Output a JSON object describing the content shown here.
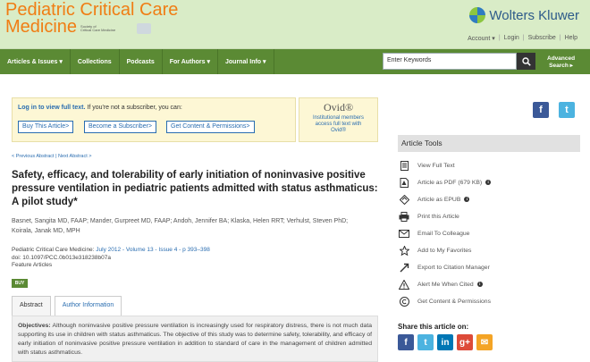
{
  "header": {
    "journal_title_line1": "Pediatric Critical Care",
    "journal_title_line2": "Medicine",
    "society_line1": "Society of",
    "society_line2": "Critical Care Medicine",
    "publisher": "Wolters Kluwer",
    "top_links": [
      "Account ▾",
      "Login",
      "Subscribe",
      "Help"
    ]
  },
  "nav": {
    "items": [
      "Articles & Issues ▾",
      "Collections",
      "Podcasts",
      "For Authors ▾",
      "Journal Info ▾"
    ],
    "search_placeholder": "Enter Keywords",
    "advanced_line1": "Advanced",
    "advanced_line2": "Search ▸"
  },
  "access": {
    "login_link": "Log in to view full text.",
    "login_rest": " If you're not a subscriber, you can:",
    "buttons": [
      "Buy This Article>",
      "Become a Subscriber>",
      "Get Content & Permissions>"
    ],
    "ovid_logo": "Ovid®",
    "ovid_line1": "Institutional members",
    "ovid_line2": "access full text with",
    "ovid_line3": "Ovid®"
  },
  "article": {
    "prev_next": "< Previous Abstract | Next Abstract >",
    "title": "Safety, efficacy, and tolerability of early initiation of noninvasive positive pressure ventilation in pediatric patients admitted with status asthmaticus: A pilot study*",
    "authors": "Basnet, Sangita MD, FAAP; Mander, Gurpreet MD, FAAP; Andoh, Jennifer BA; Klaska, Helen RRT; Verhulst, Steven PhD; Koirala, Janak MD, MPH",
    "citation_journal": "Pediatric Critical Care Medicine: ",
    "citation_issue": "July 2012 - Volume 13 - Issue 4 - p 393–398",
    "doi": "doi: 10.1097/PCC.0b013e318238b07a",
    "section": "Feature Articles",
    "buy_badge": "BUY",
    "tabs": [
      "Abstract",
      "Author Information"
    ],
    "abstract_label": "Objectives:",
    "abstract_text": " Although noninvasive positive pressure ventilation is increasingly used for respiratory distress, there is not much data supporting its use in children with status asthmaticus. The objective of this study was to determine safety, tolerability, and efficacy of early initiation of noninvasive positive pressure ventilation in addition to standard of care in the management of children admitted with status asthmaticus."
  },
  "sidebar": {
    "social_top": [
      "f",
      "t"
    ],
    "tools_title": "Article Tools",
    "tools": [
      {
        "label": "View Full Text",
        "icon": "document-icon",
        "info": false
      },
      {
        "label": "Article as PDF (679 KB)",
        "icon": "pdf-icon",
        "info": true
      },
      {
        "label": "Article as EPUB",
        "icon": "epub-icon",
        "info": true
      },
      {
        "label": "Print this Article",
        "icon": "printer-icon",
        "info": false
      },
      {
        "label": "Email To Colleague",
        "icon": "email-icon",
        "info": false
      },
      {
        "label": "Add to My Favorites",
        "icon": "star-icon",
        "info": false
      },
      {
        "label": "Export to Citation Manager",
        "icon": "export-icon",
        "info": false
      },
      {
        "label": "Alert Me When Cited",
        "icon": "alert-icon",
        "info": true
      },
      {
        "label": "Get Content & Permissions",
        "icon": "copyright-icon",
        "info": false
      }
    ],
    "share_title": "Share this article on:",
    "share_icons": [
      "f",
      "t",
      "in",
      "g+",
      "✉"
    ]
  },
  "colors": {
    "header_bg": "#d9ecc7",
    "brand_orange": "#f07d14",
    "nav_green": "#5b8a34",
    "link_blue": "#2a6db0"
  }
}
